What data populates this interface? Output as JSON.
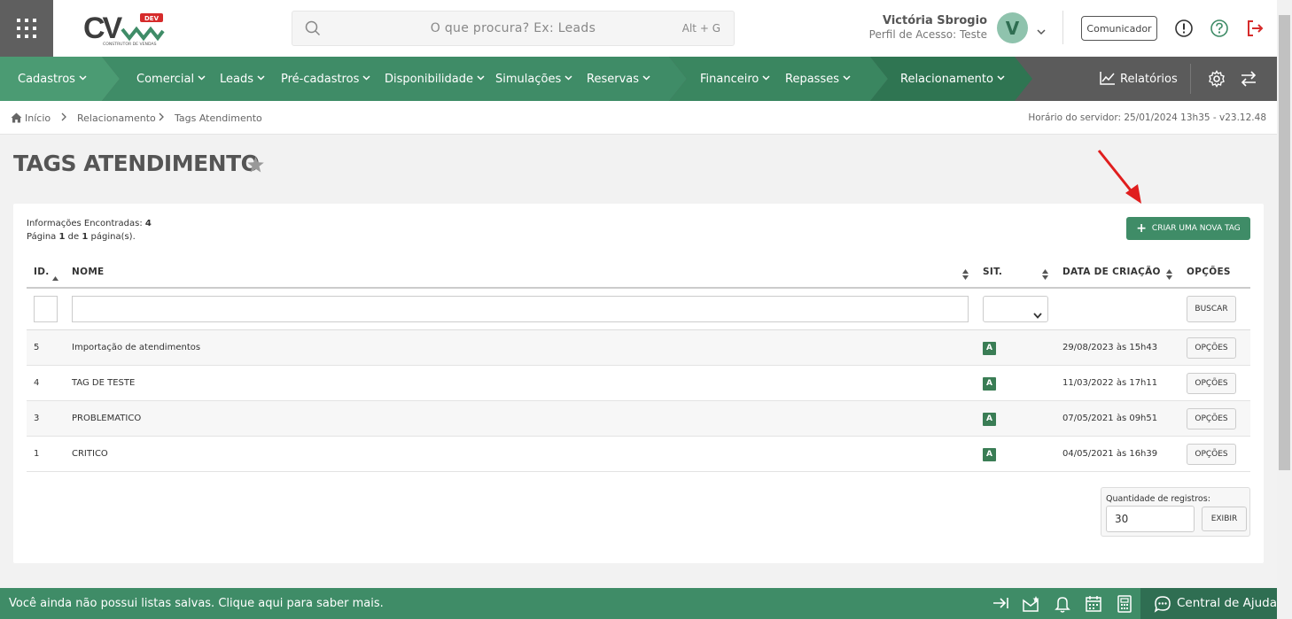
{
  "header": {
    "search_placeholder": "O que procura? Ex: Leads",
    "search_shortcut": "Alt + G",
    "user_name": "Victória Sbrogio",
    "user_profile": "Perfil de Acesso: Teste",
    "avatar_initial": "V",
    "comunicador_label": "Comunicador",
    "logo_text": "CV",
    "logo_badge": "DEV",
    "logo_subtitle": "CONSTRUTOR DE VENDAS"
  },
  "nav": {
    "items": [
      {
        "label": "Cadastros"
      },
      {
        "label": "Comercial"
      },
      {
        "label": "Leads"
      },
      {
        "label": "Pré-cadastros"
      },
      {
        "label": "Disponibilidade"
      },
      {
        "label": "Simulações"
      },
      {
        "label": "Reservas"
      },
      {
        "label": "Financeiro"
      },
      {
        "label": "Repasses"
      },
      {
        "label": "Relacionamento"
      }
    ],
    "relatorios_label": "Relatórios"
  },
  "breadcrumb": {
    "items": [
      "Início",
      "Relacionamento",
      "Tags Atendimento"
    ],
    "server_time": "Horário do servidor: 25/01/2024 13h35 - v23.12.48"
  },
  "page": {
    "title": "TAGS ATENDIMENTO",
    "info_found_label": "Informações Encontradas:",
    "info_found_count": "4",
    "pagination_prefix": "Página",
    "page_current": "1",
    "pagination_middle": "de",
    "page_total": "1",
    "pagination_suffix": "página(s).",
    "new_tag_button": "CRIAR UMA NOVA TAG"
  },
  "table": {
    "columns": [
      "ID.",
      "NOME",
      "SIT.",
      "DATA DE CRIAÇÃO",
      "OPÇÕES"
    ],
    "buscar_label": "BUSCAR",
    "rows": [
      {
        "id": "5",
        "nome": "Importação de atendimentos",
        "sit": "A",
        "data": "29/08/2023 às 15h43",
        "opcoes": "OPÇÕES"
      },
      {
        "id": "4",
        "nome": "TAG DE TESTE",
        "sit": "A",
        "data": "11/03/2022 às 17h11",
        "opcoes": "OPÇÕES"
      },
      {
        "id": "3",
        "nome": "PROBLEMATICO",
        "sit": "A",
        "data": "07/05/2021 às 09h51",
        "opcoes": "OPÇÕES"
      },
      {
        "id": "1",
        "nome": "CRITICO",
        "sit": "A",
        "data": "04/05/2021 às 16h39",
        "opcoes": "OPÇÕES"
      }
    ],
    "quantity_label": "Quantidade de registros:",
    "quantity_value": "30",
    "exibir_label": "EXIBIR"
  },
  "footer": {
    "message": "Você ainda não possui listas salvas. Clique aqui para saber mais.",
    "help_label": "Central de Ajuda"
  },
  "colors": {
    "brand_green": "#3f8c67",
    "dark_green": "#2f6e52",
    "nav_gray": "#5b5b5b",
    "alert_red": "#d62b2b"
  },
  "icons": [
    "app-grid-icon",
    "search-icon",
    "chevron-down-icon",
    "info-icon",
    "help-icon",
    "logout-icon",
    "home-icon",
    "chart-icon",
    "gear-icon",
    "swap-icon",
    "star-icon",
    "plus-icon",
    "sort-icon",
    "collapse-icon",
    "saved-list-icon",
    "bell-icon",
    "calendar-icon",
    "calculator-icon",
    "chat-icon"
  ]
}
